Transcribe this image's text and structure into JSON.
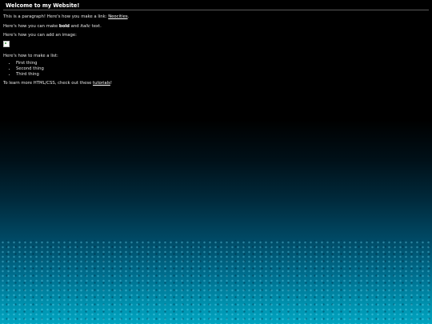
{
  "heading": "Welcome to my Website!",
  "p1": {
    "text": "This is a paragraph! Here's how you make a link:",
    "link_label": "Neocities",
    "end": "."
  },
  "p2": {
    "pre": "Here's how you can make",
    "bold": "bold",
    "mid": "and",
    "italic": "italic",
    "post": "text."
  },
  "p3": "Here's how you can add an image:",
  "p4": "Here's how to make a list:",
  "list": [
    "First thing",
    "Second thing",
    "Third thing"
  ],
  "p5": {
    "text": "To learn more HTML/CSS, check out these",
    "link_label": "tutorials",
    "end": "!"
  },
  "image_icon": "broken-image-icon"
}
